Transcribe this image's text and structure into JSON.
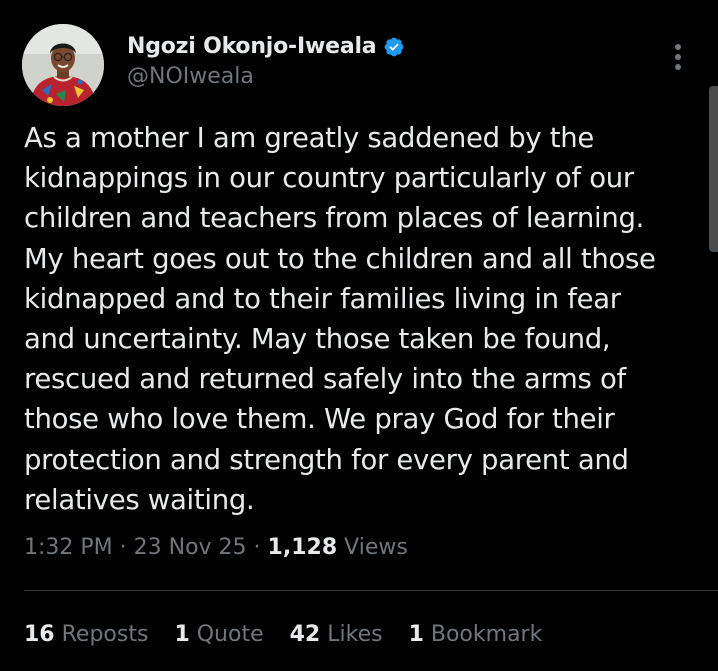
{
  "author": {
    "display_name": "Ngozi Okonjo-Iweala",
    "handle": "@NOIweala",
    "verified": true,
    "avatar_icon": "profile-photo"
  },
  "menu": {
    "icon": "more-vertical-icon"
  },
  "tweet": {
    "text": "As a mother I am greatly saddened by the\nkidnappings in our country particularly of our\nchildren and teachers from places of learning.\nMy heart goes out to the children and all those\nkidnapped and to their families living in fear\nand uncertainty. May those taken be found,\nrescued and returned safely into the arms of\nthose who love them. We pray God for their\nprotection and strength for every parent and\nrelatives waiting."
  },
  "meta": {
    "time": "1:32 PM",
    "sep1": " · ",
    "date": "23 Nov 25",
    "sep2": " · ",
    "views_count": "1,128",
    "views_label": " Views"
  },
  "stats": [
    {
      "count": "16",
      "label": " Reposts"
    },
    {
      "count": "1",
      "label": " Quote"
    },
    {
      "count": "42",
      "label": " Likes"
    },
    {
      "count": "1",
      "label": " Bookmark"
    }
  ],
  "colors": {
    "background": "#000000",
    "primary_text": "#e7e9ea",
    "secondary_text": "#71767b",
    "verified_blue": "#1d9bf0",
    "divider": "#2f3336"
  }
}
